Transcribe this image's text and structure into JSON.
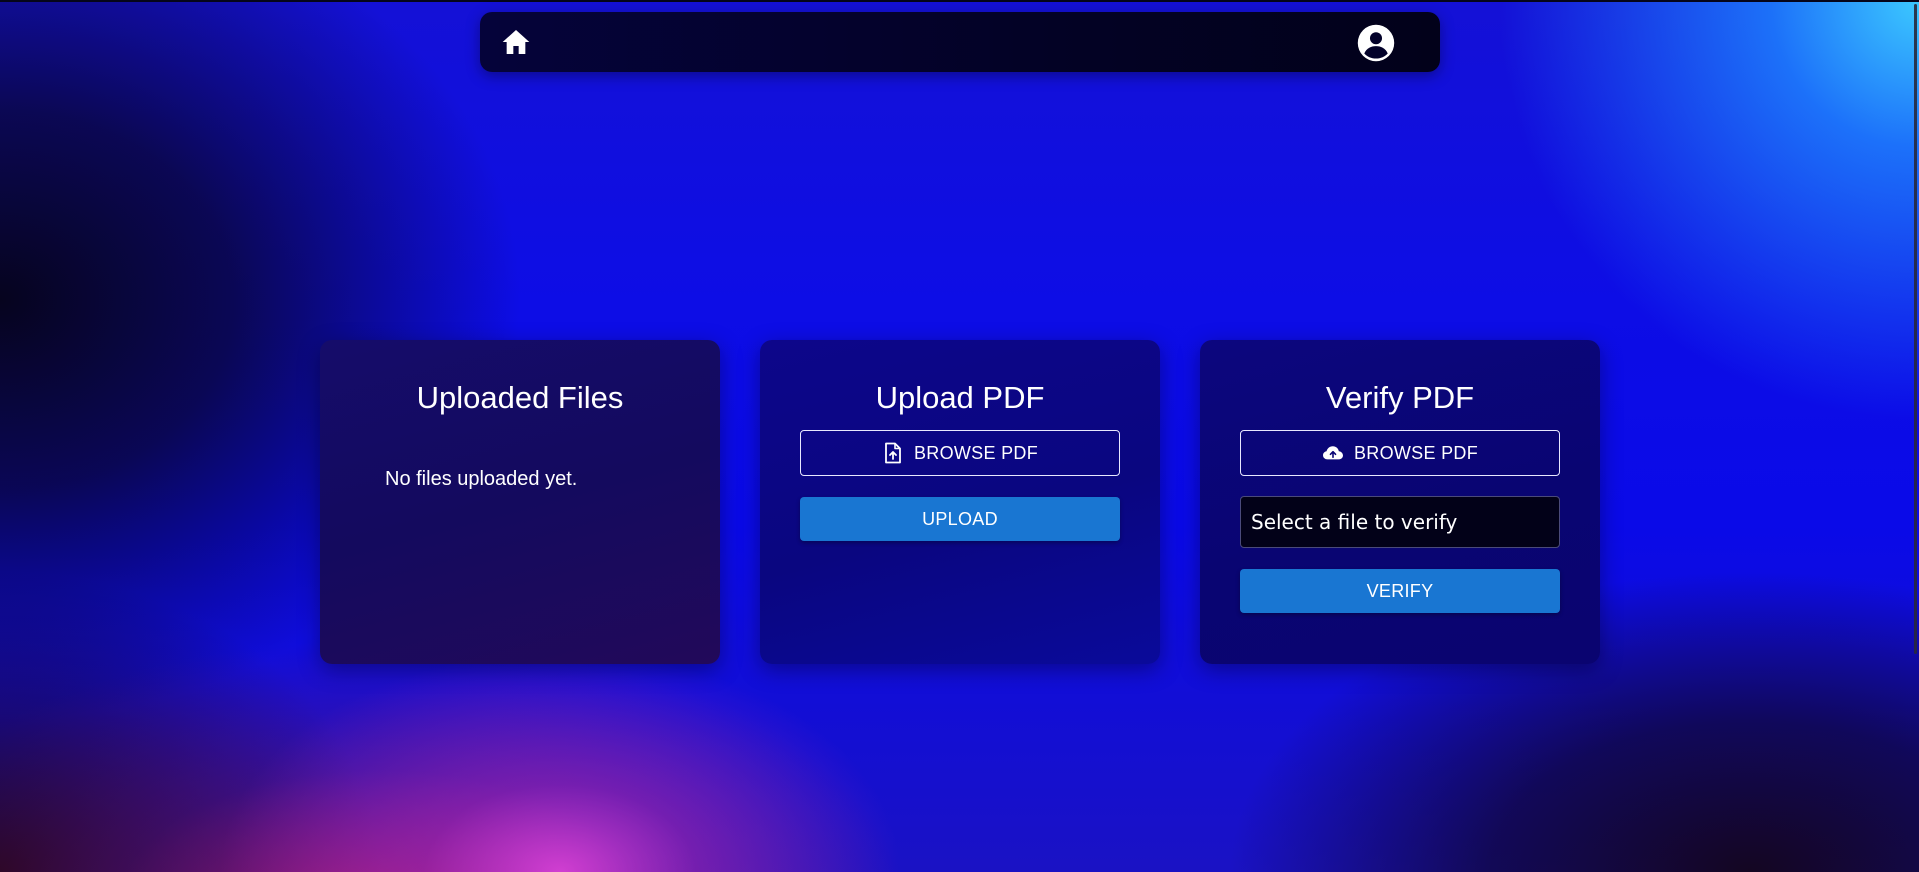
{
  "navbar": {
    "home_icon": "home-icon",
    "profile_icon": "account-circle-icon"
  },
  "cards": {
    "uploaded_files": {
      "title": "Uploaded Files",
      "empty_message": "No files uploaded yet."
    },
    "upload_pdf": {
      "title": "Upload PDF",
      "browse_label": "BROWSE PDF",
      "browse_icon": "file-upload-icon",
      "upload_label": "UPLOAD"
    },
    "verify_pdf": {
      "title": "Verify PDF",
      "browse_label": "BROWSE PDF",
      "browse_icon": "cloud-upload-icon",
      "select_value": "Select a file to verify",
      "verify_label": "VERIFY"
    }
  },
  "colors": {
    "primary_button": "#1976d2",
    "navbar_bg": "#03022a",
    "text": "#ffffff"
  }
}
